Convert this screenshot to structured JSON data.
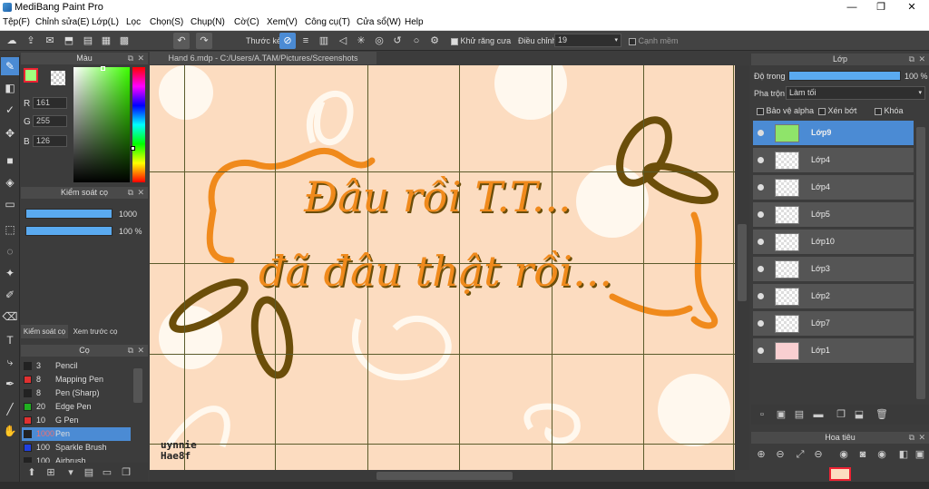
{
  "window": {
    "title": "MediBang Paint Pro",
    "min": "—",
    "max": "❐",
    "close": "✕"
  },
  "menu": [
    "Tệp(F)",
    "Chỉnh sửa(E)",
    "Lớp(L)",
    "Lọc",
    "Chọn(S)",
    "Chụp(N)",
    "Cờ(C)",
    "Xem(V)",
    "Công cụ(T)",
    "Cửa sổ(W)",
    "Help"
  ],
  "toolbar": {
    "ruler_label": "Thước kẻ",
    "antialias_label": "Khử răng cưa",
    "correction_label": "Điều chỉnh",
    "correction_value": "19",
    "sharp_label": "Cạnh mềm"
  },
  "color_panel": {
    "title": "Màu",
    "r_label": "R",
    "r": "161",
    "g_label": "G",
    "g": "255",
    "b_label": "B",
    "b": "126",
    "fg_color": "#a1ff7e"
  },
  "brush_control": {
    "title": "Kiểm soát cọ",
    "size": "1000",
    "opacity": "100 %"
  },
  "tabs": {
    "brush_control": "Kiểm soát cọ",
    "brush_preview": "Xem trước cọ"
  },
  "brush_panel": {
    "title": "Cọ",
    "items": [
      {
        "size": "3",
        "name": "Pencil",
        "color": "#222222"
      },
      {
        "size": "8",
        "name": "Mapping Pen",
        "color": "#e03030"
      },
      {
        "size": "8",
        "name": "Pen (Sharp)",
        "color": "#222222"
      },
      {
        "size": "20",
        "name": "Edge Pen",
        "color": "#20b020"
      },
      {
        "size": "10",
        "name": "G Pen",
        "color": "#e03030"
      },
      {
        "size": "1000",
        "name": "Pen",
        "color": "#222222"
      },
      {
        "size": "100",
        "name": "Sparkle Brush",
        "color": "#2040e0"
      },
      {
        "size": "100",
        "name": "Airbrush",
        "color": "#222222"
      }
    ]
  },
  "document": {
    "tab": "Hand 6.mdp - C:/Users/A.TAM/Pictures/Screenshots"
  },
  "artwork": {
    "line1": "Đâu rồi T.T...",
    "line2": "đã đâu thật rồi...",
    "signature1": "uynnie",
    "signature2": "Hae8f"
  },
  "layer_panel": {
    "title": "Lớp",
    "opacity_label": "Độ trong",
    "opacity_value": "100 %",
    "blend_label": "Pha trộn",
    "blend_value": "Làm tối",
    "protect_alpha": "Bảo vệ alpha",
    "clipping": "Xén bớt",
    "lock": "Khóa",
    "layers": [
      {
        "name": "Lớp9",
        "active": true
      },
      {
        "name": "Lớp4",
        "active": false
      },
      {
        "name": "Lớp4",
        "active": false
      },
      {
        "name": "Lớp5",
        "active": false
      },
      {
        "name": "Lớp10",
        "active": false
      },
      {
        "name": "Lớp3",
        "active": false
      },
      {
        "name": "Lớp2",
        "active": false
      },
      {
        "name": "Lớp7",
        "active": false
      },
      {
        "name": "Lớp1",
        "active": false
      }
    ]
  },
  "navigator": {
    "title": "Hoa tiêu"
  },
  "colors": {
    "accent": "#4b8bd4",
    "canvas_bg": "#fcdcc0",
    "orange": "#f08a1c",
    "olive": "#6b4e0a"
  }
}
